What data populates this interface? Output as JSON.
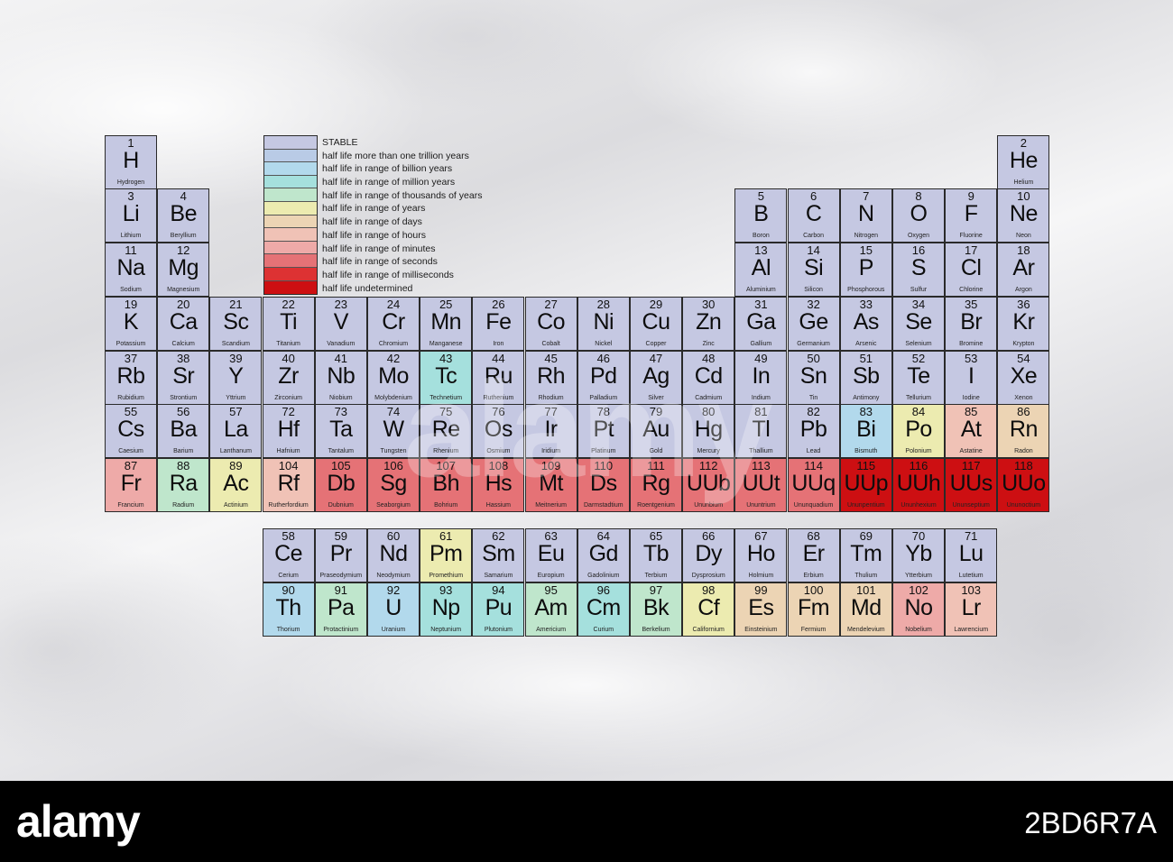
{
  "colors": {
    "stable": "#c5c8e2",
    "trillion_years": "#b9cbe6",
    "billion_years": "#b2d9ec",
    "million_years": "#a5e0dd",
    "thousands_years": "#bfe6cc",
    "years": "#ecebb0",
    "days": "#ecd4b4",
    "hours": "#f0c2b6",
    "minutes": "#eeaaa8",
    "seconds": "#e57276",
    "milliseconds": "#dd3233",
    "undetermined": "#cd0f12"
  },
  "legend": [
    {
      "color": "stable",
      "label": "STABLE"
    },
    {
      "color": "trillion_years",
      "label": "half life more than one trillion years"
    },
    {
      "color": "billion_years",
      "label": "half life in range of billion years"
    },
    {
      "color": "million_years",
      "label": "half life in range of million years"
    },
    {
      "color": "thousands_years",
      "label": "half life in range of thousands of years"
    },
    {
      "color": "years",
      "label": "half life in range of years"
    },
    {
      "color": "days",
      "label": "half life in range of days"
    },
    {
      "color": "hours",
      "label": "half life in range of hours"
    },
    {
      "color": "minutes",
      "label": "half life in range of minutes"
    },
    {
      "color": "seconds",
      "label": "half life in range of seconds"
    },
    {
      "color": "milliseconds",
      "label": "half life in range of milliseconds"
    },
    {
      "color": "undetermined",
      "label": "half life undetermined"
    }
  ],
  "elements": [
    {
      "n": "1",
      "s": "H",
      "name": "Hydrogen",
      "c": "stable",
      "r": 1,
      "g": 1
    },
    {
      "n": "2",
      "s": "He",
      "name": "Helium",
      "c": "stable",
      "r": 1,
      "g": 18
    },
    {
      "n": "3",
      "s": "Li",
      "name": "Lithium",
      "c": "stable",
      "r": 2,
      "g": 1
    },
    {
      "n": "4",
      "s": "Be",
      "name": "Beryllium",
      "c": "stable",
      "r": 2,
      "g": 2
    },
    {
      "n": "5",
      "s": "B",
      "name": "Boron",
      "c": "stable",
      "r": 2,
      "g": 13
    },
    {
      "n": "6",
      "s": "C",
      "name": "Carbon",
      "c": "stable",
      "r": 2,
      "g": 14
    },
    {
      "n": "7",
      "s": "N",
      "name": "Nitrogen",
      "c": "stable",
      "r": 2,
      "g": 15
    },
    {
      "n": "8",
      "s": "O",
      "name": "Oxygen",
      "c": "stable",
      "r": 2,
      "g": 16
    },
    {
      "n": "9",
      "s": "F",
      "name": "Fluorine",
      "c": "stable",
      "r": 2,
      "g": 17
    },
    {
      "n": "10",
      "s": "Ne",
      "name": "Neon",
      "c": "stable",
      "r": 2,
      "g": 18
    },
    {
      "n": "11",
      "s": "Na",
      "name": "Sodium",
      "c": "stable",
      "r": 3,
      "g": 1
    },
    {
      "n": "12",
      "s": "Mg",
      "name": "Magnesium",
      "c": "stable",
      "r": 3,
      "g": 2
    },
    {
      "n": "13",
      "s": "Al",
      "name": "Aluminium",
      "c": "stable",
      "r": 3,
      "g": 13
    },
    {
      "n": "14",
      "s": "Si",
      "name": "Silicon",
      "c": "stable",
      "r": 3,
      "g": 14
    },
    {
      "n": "15",
      "s": "P",
      "name": "Phosphorous",
      "c": "stable",
      "r": 3,
      "g": 15
    },
    {
      "n": "16",
      "s": "S",
      "name": "Sulfur",
      "c": "stable",
      "r": 3,
      "g": 16
    },
    {
      "n": "17",
      "s": "Cl",
      "name": "Chlorine",
      "c": "stable",
      "r": 3,
      "g": 17
    },
    {
      "n": "18",
      "s": "Ar",
      "name": "Argon",
      "c": "stable",
      "r": 3,
      "g": 18
    },
    {
      "n": "19",
      "s": "K",
      "name": "Potassium",
      "c": "stable",
      "r": 4,
      "g": 1
    },
    {
      "n": "20",
      "s": "Ca",
      "name": "Calcium",
      "c": "stable",
      "r": 4,
      "g": 2
    },
    {
      "n": "21",
      "s": "Sc",
      "name": "Scandium",
      "c": "stable",
      "r": 4,
      "g": 3
    },
    {
      "n": "22",
      "s": "Ti",
      "name": "Titanium",
      "c": "stable",
      "r": 4,
      "g": 4
    },
    {
      "n": "23",
      "s": "V",
      "name": "Vanadium",
      "c": "stable",
      "r": 4,
      "g": 5
    },
    {
      "n": "24",
      "s": "Cr",
      "name": "Chromium",
      "c": "stable",
      "r": 4,
      "g": 6
    },
    {
      "n": "25",
      "s": "Mn",
      "name": "Manganese",
      "c": "stable",
      "r": 4,
      "g": 7
    },
    {
      "n": "26",
      "s": "Fe",
      "name": "Iron",
      "c": "stable",
      "r": 4,
      "g": 8
    },
    {
      "n": "27",
      "s": "Co",
      "name": "Cobalt",
      "c": "stable",
      "r": 4,
      "g": 9
    },
    {
      "n": "28",
      "s": "Ni",
      "name": "Nickel",
      "c": "stable",
      "r": 4,
      "g": 10
    },
    {
      "n": "29",
      "s": "Cu",
      "name": "Copper",
      "c": "stable",
      "r": 4,
      "g": 11
    },
    {
      "n": "30",
      "s": "Zn",
      "name": "Zinc",
      "c": "stable",
      "r": 4,
      "g": 12
    },
    {
      "n": "31",
      "s": "Ga",
      "name": "Gallium",
      "c": "stable",
      "r": 4,
      "g": 13
    },
    {
      "n": "32",
      "s": "Ge",
      "name": "Germanium",
      "c": "stable",
      "r": 4,
      "g": 14
    },
    {
      "n": "33",
      "s": "As",
      "name": "Arsenic",
      "c": "stable",
      "r": 4,
      "g": 15
    },
    {
      "n": "34",
      "s": "Se",
      "name": "Selenium",
      "c": "stable",
      "r": 4,
      "g": 16
    },
    {
      "n": "35",
      "s": "Br",
      "name": "Bromine",
      "c": "stable",
      "r": 4,
      "g": 17
    },
    {
      "n": "36",
      "s": "Kr",
      "name": "Krypton",
      "c": "stable",
      "r": 4,
      "g": 18
    },
    {
      "n": "37",
      "s": "Rb",
      "name": "Rubidium",
      "c": "stable",
      "r": 5,
      "g": 1
    },
    {
      "n": "38",
      "s": "Sr",
      "name": "Strontium",
      "c": "stable",
      "r": 5,
      "g": 2
    },
    {
      "n": "39",
      "s": "Y",
      "name": "Yttrium",
      "c": "stable",
      "r": 5,
      "g": 3
    },
    {
      "n": "40",
      "s": "Zr",
      "name": "Zirconium",
      "c": "stable",
      "r": 5,
      "g": 4
    },
    {
      "n": "41",
      "s": "Nb",
      "name": "Niobium",
      "c": "stable",
      "r": 5,
      "g": 5
    },
    {
      "n": "42",
      "s": "Mo",
      "name": "Molybdenium",
      "c": "stable",
      "r": 5,
      "g": 6
    },
    {
      "n": "43",
      "s": "Tc",
      "name": "Technetium",
      "c": "million_years",
      "r": 5,
      "g": 7
    },
    {
      "n": "44",
      "s": "Ru",
      "name": "Ruthenium",
      "c": "stable",
      "r": 5,
      "g": 8
    },
    {
      "n": "45",
      "s": "Rh",
      "name": "Rhodium",
      "c": "stable",
      "r": 5,
      "g": 9
    },
    {
      "n": "46",
      "s": "Pd",
      "name": "Palladium",
      "c": "stable",
      "r": 5,
      "g": 10
    },
    {
      "n": "47",
      "s": "Ag",
      "name": "Silver",
      "c": "stable",
      "r": 5,
      "g": 11
    },
    {
      "n": "48",
      "s": "Cd",
      "name": "Cadmium",
      "c": "stable",
      "r": 5,
      "g": 12
    },
    {
      "n": "49",
      "s": "In",
      "name": "Indium",
      "c": "stable",
      "r": 5,
      "g": 13
    },
    {
      "n": "50",
      "s": "Sn",
      "name": "Tin",
      "c": "stable",
      "r": 5,
      "g": 14
    },
    {
      "n": "51",
      "s": "Sb",
      "name": "Antimony",
      "c": "stable",
      "r": 5,
      "g": 15
    },
    {
      "n": "52",
      "s": "Te",
      "name": "Tellurium",
      "c": "stable",
      "r": 5,
      "g": 16
    },
    {
      "n": "53",
      "s": "I",
      "name": "Iodine",
      "c": "stable",
      "r": 5,
      "g": 17
    },
    {
      "n": "54",
      "s": "Xe",
      "name": "Xenon",
      "c": "stable",
      "r": 5,
      "g": 18
    },
    {
      "n": "55",
      "s": "Cs",
      "name": "Caesium",
      "c": "stable",
      "r": 6,
      "g": 1
    },
    {
      "n": "56",
      "s": "Ba",
      "name": "Barium",
      "c": "stable",
      "r": 6,
      "g": 2
    },
    {
      "n": "57",
      "s": "La",
      "name": "Lanthanum",
      "c": "stable",
      "r": 6,
      "g": 3
    },
    {
      "n": "72",
      "s": "Hf",
      "name": "Hafnium",
      "c": "stable",
      "r": 6,
      "g": 4
    },
    {
      "n": "73",
      "s": "Ta",
      "name": "Tantalum",
      "c": "stable",
      "r": 6,
      "g": 5
    },
    {
      "n": "74",
      "s": "W",
      "name": "Tungsten",
      "c": "stable",
      "r": 6,
      "g": 6
    },
    {
      "n": "75",
      "s": "Re",
      "name": "Rhenium",
      "c": "stable",
      "r": 6,
      "g": 7
    },
    {
      "n": "76",
      "s": "Os",
      "name": "Osmium",
      "c": "stable",
      "r": 6,
      "g": 8
    },
    {
      "n": "77",
      "s": "Ir",
      "name": "Iridium",
      "c": "stable",
      "r": 6,
      "g": 9
    },
    {
      "n": "78",
      "s": "Pt",
      "name": "Platinum",
      "c": "stable",
      "r": 6,
      "g": 10
    },
    {
      "n": "79",
      "s": "Au",
      "name": "Gold",
      "c": "stable",
      "r": 6,
      "g": 11
    },
    {
      "n": "80",
      "s": "Hg",
      "name": "Mercury",
      "c": "stable",
      "r": 6,
      "g": 12
    },
    {
      "n": "81",
      "s": "Tl",
      "name": "Thallium",
      "c": "stable",
      "r": 6,
      "g": 13
    },
    {
      "n": "82",
      "s": "Pb",
      "name": "Lead",
      "c": "stable",
      "r": 6,
      "g": 14
    },
    {
      "n": "83",
      "s": "Bi",
      "name": "Bismuth",
      "c": "billion_years",
      "r": 6,
      "g": 15
    },
    {
      "n": "84",
      "s": "Po",
      "name": "Polonium",
      "c": "years",
      "r": 6,
      "g": 16
    },
    {
      "n": "85",
      "s": "At",
      "name": "Astatine",
      "c": "hours",
      "r": 6,
      "g": 17
    },
    {
      "n": "86",
      "s": "Rn",
      "name": "Radon",
      "c": "days",
      "r": 6,
      "g": 18
    },
    {
      "n": "87",
      "s": "Fr",
      "name": "Francium",
      "c": "minutes",
      "r": 7,
      "g": 1
    },
    {
      "n": "88",
      "s": "Ra",
      "name": "Radium",
      "c": "thousands_years",
      "r": 7,
      "g": 2
    },
    {
      "n": "89",
      "s": "Ac",
      "name": "Actinium",
      "c": "years",
      "r": 7,
      "g": 3
    },
    {
      "n": "104",
      "s": "Rf",
      "name": "Rutherfordium",
      "c": "hours",
      "r": 7,
      "g": 4
    },
    {
      "n": "105",
      "s": "Db",
      "name": "Dubnium",
      "c": "seconds",
      "r": 7,
      "g": 5
    },
    {
      "n": "106",
      "s": "Sg",
      "name": "Seaborgium",
      "c": "seconds",
      "r": 7,
      "g": 6
    },
    {
      "n": "107",
      "s": "Bh",
      "name": "Bohrium",
      "c": "seconds",
      "r": 7,
      "g": 7
    },
    {
      "n": "108",
      "s": "Hs",
      "name": "Hassium",
      "c": "seconds",
      "r": 7,
      "g": 8
    },
    {
      "n": "109",
      "s": "Mt",
      "name": "Meitnerium",
      "c": "seconds",
      "r": 7,
      "g": 9
    },
    {
      "n": "110",
      "s": "Ds",
      "name": "Darmstadtium",
      "c": "seconds",
      "r": 7,
      "g": 10
    },
    {
      "n": "111",
      "s": "Rg",
      "name": "Roentgenium",
      "c": "seconds",
      "r": 7,
      "g": 11
    },
    {
      "n": "112",
      "s": "UUb",
      "name": "Ununbium",
      "c": "seconds",
      "r": 7,
      "g": 12
    },
    {
      "n": "113",
      "s": "UUt",
      "name": "Ununtrium",
      "c": "seconds",
      "r": 7,
      "g": 13
    },
    {
      "n": "114",
      "s": "UUq",
      "name": "Ununquadium",
      "c": "seconds",
      "r": 7,
      "g": 14
    },
    {
      "n": "115",
      "s": "UUp",
      "name": "Ununpentium",
      "c": "undetermined",
      "r": 7,
      "g": 15
    },
    {
      "n": "116",
      "s": "UUh",
      "name": "Ununhexium",
      "c": "undetermined",
      "r": 7,
      "g": 16
    },
    {
      "n": "117",
      "s": "UUs",
      "name": "Ununseptium",
      "c": "undetermined",
      "r": 7,
      "g": 17
    },
    {
      "n": "118",
      "s": "UUo",
      "name": "Ununoctium",
      "c": "undetermined",
      "r": 7,
      "g": 18
    },
    {
      "n": "58",
      "s": "Ce",
      "name": "Cerium",
      "c": "stable",
      "r": 9,
      "g": 4
    },
    {
      "n": "59",
      "s": "Pr",
      "name": "Praseodymium",
      "c": "stable",
      "r": 9,
      "g": 5
    },
    {
      "n": "60",
      "s": "Nd",
      "name": "Neodymium",
      "c": "stable",
      "r": 9,
      "g": 6
    },
    {
      "n": "61",
      "s": "Pm",
      "name": "Promethium",
      "c": "years",
      "r": 9,
      "g": 7
    },
    {
      "n": "62",
      "s": "Sm",
      "name": "Samarium",
      "c": "stable",
      "r": 9,
      "g": 8
    },
    {
      "n": "63",
      "s": "Eu",
      "name": "Europium",
      "c": "stable",
      "r": 9,
      "g": 9
    },
    {
      "n": "64",
      "s": "Gd",
      "name": "Gadolinium",
      "c": "stable",
      "r": 9,
      "g": 10
    },
    {
      "n": "65",
      "s": "Tb",
      "name": "Terbium",
      "c": "stable",
      "r": 9,
      "g": 11
    },
    {
      "n": "66",
      "s": "Dy",
      "name": "Dysprosium",
      "c": "stable",
      "r": 9,
      "g": 12
    },
    {
      "n": "67",
      "s": "Ho",
      "name": "Holmium",
      "c": "stable",
      "r": 9,
      "g": 13
    },
    {
      "n": "68",
      "s": "Er",
      "name": "Erbium",
      "c": "stable",
      "r": 9,
      "g": 14
    },
    {
      "n": "69",
      "s": "Tm",
      "name": "Thulium",
      "c": "stable",
      "r": 9,
      "g": 15
    },
    {
      "n": "70",
      "s": "Yb",
      "name": "Ytterbium",
      "c": "stable",
      "r": 9,
      "g": 16
    },
    {
      "n": "71",
      "s": "Lu",
      "name": "Lutetium",
      "c": "stable",
      "r": 9,
      "g": 17
    },
    {
      "n": "90",
      "s": "Th",
      "name": "Thorium",
      "c": "billion_years",
      "r": 10,
      "g": 4
    },
    {
      "n": "91",
      "s": "Pa",
      "name": "Protactinium",
      "c": "thousands_years",
      "r": 10,
      "g": 5
    },
    {
      "n": "92",
      "s": "U",
      "name": "Uranium",
      "c": "billion_years",
      "r": 10,
      "g": 6
    },
    {
      "n": "93",
      "s": "Np",
      "name": "Neptunium",
      "c": "million_years",
      "r": 10,
      "g": 7
    },
    {
      "n": "94",
      "s": "Pu",
      "name": "Plutonium",
      "c": "million_years",
      "r": 10,
      "g": 8
    },
    {
      "n": "95",
      "s": "Am",
      "name": "Americium",
      "c": "thousands_years",
      "r": 10,
      "g": 9
    },
    {
      "n": "96",
      "s": "Cm",
      "name": "Curium",
      "c": "million_years",
      "r": 10,
      "g": 10
    },
    {
      "n": "97",
      "s": "Bk",
      "name": "Berkelium",
      "c": "thousands_years",
      "r": 10,
      "g": 11
    },
    {
      "n": "98",
      "s": "Cf",
      "name": "Californium",
      "c": "years",
      "r": 10,
      "g": 12
    },
    {
      "n": "99",
      "s": "Es",
      "name": "Einsteinium",
      "c": "days",
      "r": 10,
      "g": 13
    },
    {
      "n": "100",
      "s": "Fm",
      "name": "Fermium",
      "c": "days",
      "r": 10,
      "g": 14
    },
    {
      "n": "101",
      "s": "Md",
      "name": "Mendelevium",
      "c": "days",
      "r": 10,
      "g": 15
    },
    {
      "n": "102",
      "s": "No",
      "name": "Nobelium",
      "c": "minutes",
      "r": 10,
      "g": 16
    },
    {
      "n": "103",
      "s": "Lr",
      "name": "Lawrencium",
      "c": "hours",
      "r": 10,
      "g": 17
    }
  ],
  "watermark": {
    "brand": "alamy",
    "overlay": "alamy",
    "image_id": "2BD6R7A"
  }
}
